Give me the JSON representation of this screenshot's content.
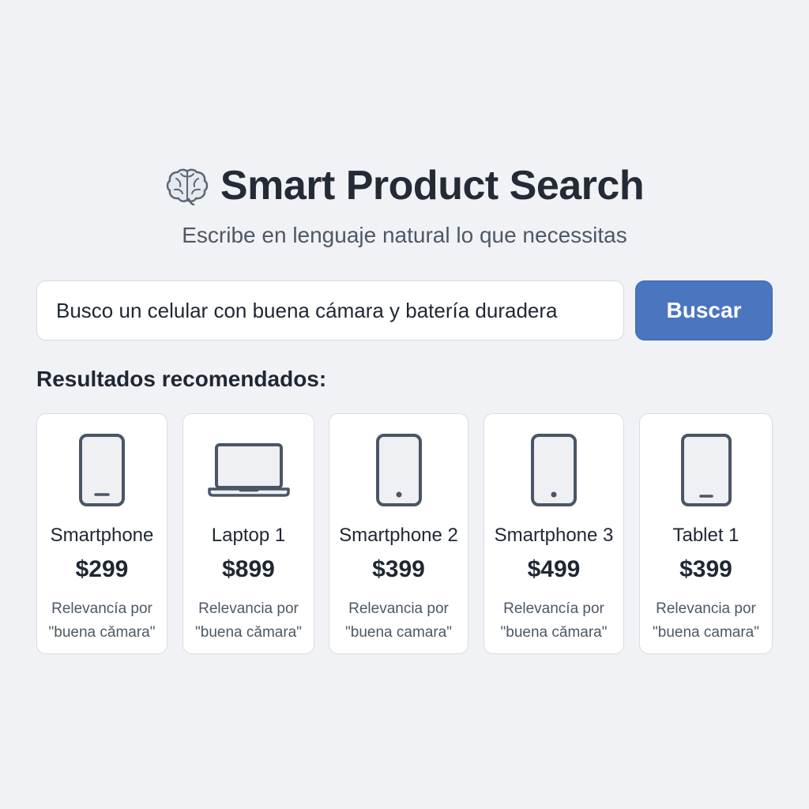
{
  "header": {
    "brain_icon": "brain-icon",
    "title": "Smart Product Search",
    "subtitle": "Escribe en lenguaje natural lo que necessitas"
  },
  "search": {
    "value": "Busco un celular con buena cámara y batería duradera",
    "button_label": "Buscar"
  },
  "results": {
    "heading": "Resultados recomendados:",
    "items": [
      {
        "icon": "smartphone-icon",
        "name": "Smartphone",
        "price": "$299",
        "relevance_line1": "Relevancía por",
        "relevance_line2": "\"buena cǎmara\""
      },
      {
        "icon": "laptop-icon",
        "name": "Laptop 1",
        "price": "$899",
        "relevance_line1": "Relevancia por",
        "relevance_line2": "\"buena cǎmara\""
      },
      {
        "icon": "smartphone-icon",
        "name": "Smartphone 2",
        "price": "$399",
        "relevance_line1": "Relevancia por",
        "relevance_line2": "\"buena camara\""
      },
      {
        "icon": "smartphone-icon",
        "name": "Smartphone 3",
        "price": "$499",
        "relevance_line1": "Relevancía por",
        "relevance_line2": "\"buena cǎmara\""
      },
      {
        "icon": "tablet-icon",
        "name": "Tablet 1",
        "price": "$399",
        "relevance_line1": "Relevancia por",
        "relevance_line2": "\"buena camara\""
      }
    ]
  },
  "colors": {
    "background": "#f1f2f5",
    "accent": "#4a75bf",
    "text": "#1f2733",
    "icon_stroke": "#4a5666"
  }
}
